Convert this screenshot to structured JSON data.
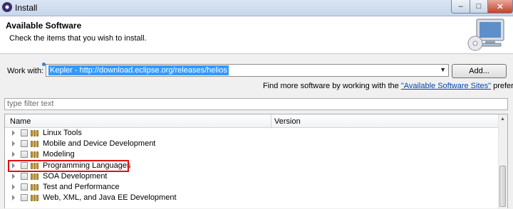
{
  "window": {
    "title": "Install",
    "min_glyph": "–",
    "max_glyph": "□",
    "close_glyph": "✕"
  },
  "header": {
    "title": "Available Software",
    "subtitle": "Check the items that you wish to install."
  },
  "work_with": {
    "label": "Work with:",
    "value": "Kepler - http://download.eclipse.org/releases/helios",
    "add_button": "Add..."
  },
  "find_more": {
    "prefix": "Find more software by working with the ",
    "link": "\"Available Software Sites\"",
    "suffix": " preferences."
  },
  "filter": {
    "placeholder": "type filter text"
  },
  "table": {
    "columns": [
      "Name",
      "Version"
    ],
    "rows": [
      {
        "label": "Linux Tools"
      },
      {
        "label": "Mobile and Device Development"
      },
      {
        "label": "Modeling"
      },
      {
        "label": "Programming Languages"
      },
      {
        "label": "SOA Development"
      },
      {
        "label": "Test and Performance"
      },
      {
        "label": "Web, XML, and Java EE Development"
      }
    ]
  },
  "colors": {
    "highlight": "#e01010",
    "selection": "#3399ff",
    "link": "#0645ad"
  }
}
